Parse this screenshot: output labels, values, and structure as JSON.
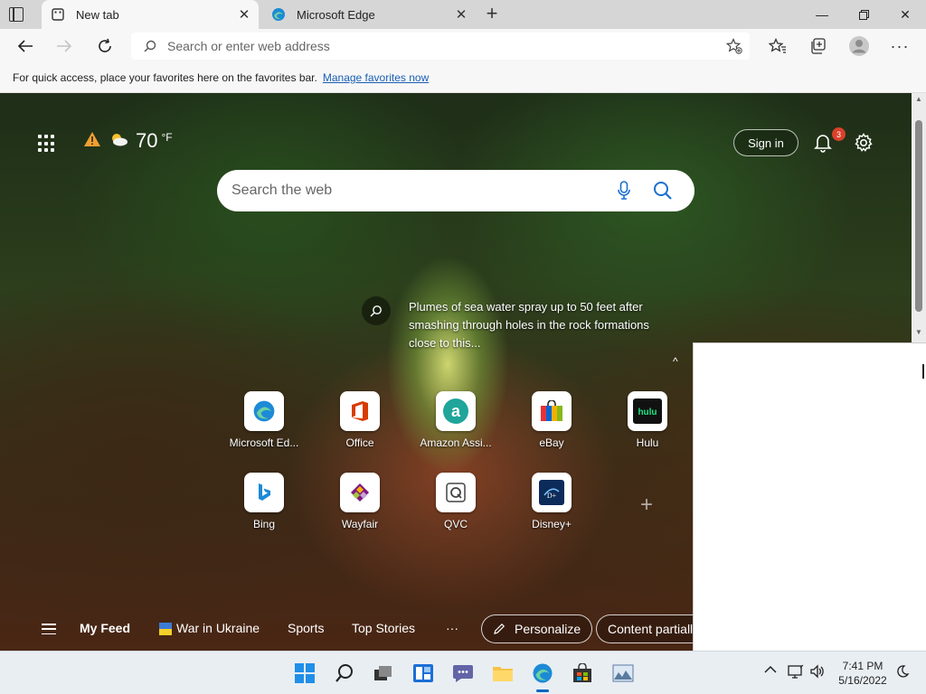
{
  "browser": {
    "tabs": [
      {
        "label": "New tab",
        "active": true
      },
      {
        "label": "Microsoft Edge",
        "active": false
      }
    ],
    "address_placeholder": "Search or enter web address",
    "favorites_message": "For quick access, place your favorites here on the favorites bar.",
    "favorites_link": "Manage favorites now"
  },
  "newtab": {
    "weather": {
      "temp": "70",
      "unit": "°F"
    },
    "signin_label": "Sign in",
    "notification_count": "3",
    "search_placeholder": "Search the web",
    "image_caption": "Plumes of sea water spray up to 50 feet after smashing through holes in the rock formations close to this...",
    "quick_links": [
      {
        "label": "Microsoft Ed..."
      },
      {
        "label": "Office"
      },
      {
        "label": "Amazon Assi..."
      },
      {
        "label": "eBay"
      },
      {
        "label": "Hulu"
      },
      {
        "label": "Bing"
      },
      {
        "label": "Wayfair"
      },
      {
        "label": "QVC"
      },
      {
        "label": "Disney+"
      }
    ],
    "feed": {
      "my_feed": "My Feed",
      "war_in_ukraine": "War in Ukraine",
      "sports": "Sports",
      "top_stories": "Top Stories",
      "more": "···",
      "personalize": "Personalize",
      "content_partial": "Content partiall"
    }
  },
  "taskbar": {
    "time": "7:41 PM",
    "date": "5/16/2022"
  },
  "colors": {
    "accent": "#0067c0",
    "link": "#1a5fb4",
    "badge": "#d9412b"
  }
}
